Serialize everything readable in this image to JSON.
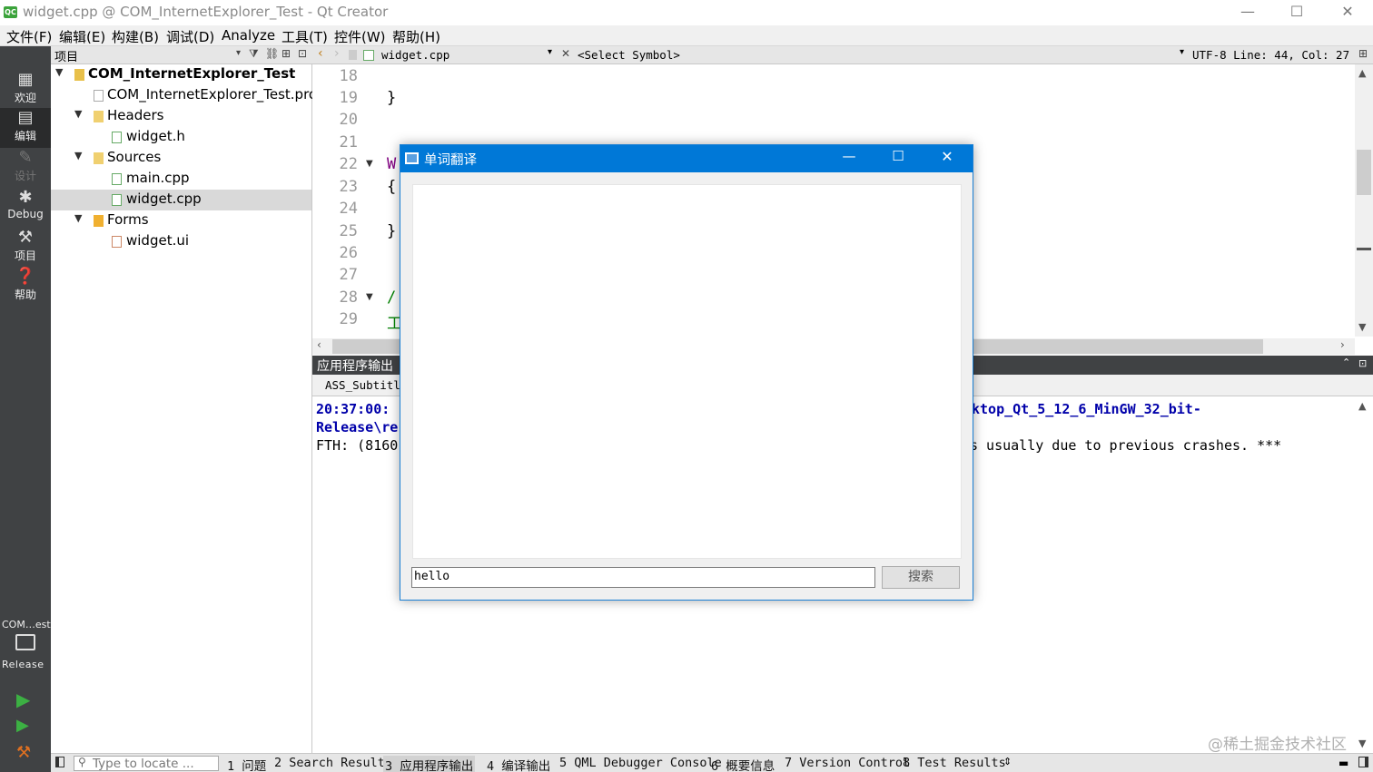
{
  "window": {
    "title": "widget.cpp @ COM_InternetExplorer_Test - Qt Creator",
    "app_icon_text": "QC",
    "minimize": "—",
    "maximize": "☐",
    "close": "✕"
  },
  "menu": [
    "文件(F)",
    "编辑(E)",
    "构建(B)",
    "调试(D)",
    "Analyze",
    "工具(T)",
    "控件(W)",
    "帮助(H)"
  ],
  "modes": [
    {
      "label": "欢迎",
      "icon": "grid-icon"
    },
    {
      "label": "编辑",
      "icon": "edit-icon"
    },
    {
      "label": "设计",
      "icon": "design-icon"
    },
    {
      "label": "Debug",
      "icon": "bug-icon"
    },
    {
      "label": "项目",
      "icon": "wrench-icon"
    },
    {
      "label": "帮助",
      "icon": "help-icon"
    }
  ],
  "kit": {
    "project": "COM…est",
    "config": "Release"
  },
  "project_panel": {
    "title": "项目",
    "tree": [
      {
        "label": "COM_InternetExplorer_Test",
        "level": 0,
        "expanded": true,
        "type": "project"
      },
      {
        "label": "COM_InternetExplorer_Test.pro",
        "level": 1,
        "type": "pro"
      },
      {
        "label": "Headers",
        "level": 1,
        "expanded": true,
        "type": "folder"
      },
      {
        "label": "widget.h",
        "level": 2,
        "type": "header"
      },
      {
        "label": "Sources",
        "level": 1,
        "expanded": true,
        "type": "folder"
      },
      {
        "label": "main.cpp",
        "level": 2,
        "type": "source"
      },
      {
        "label": "widget.cpp",
        "level": 2,
        "type": "source",
        "selected": true
      },
      {
        "label": "Forms",
        "level": 1,
        "expanded": true,
        "type": "forms"
      },
      {
        "label": "widget.ui",
        "level": 2,
        "type": "ui"
      }
    ]
  },
  "editor": {
    "file": "widget.cpp",
    "symbol": "<Select Symbol>",
    "position": "UTF-8 Line: 44, Col: 27",
    "line_numbers": [
      "18",
      "19",
      "20",
      "21",
      "22",
      "23",
      "24",
      "25",
      "26",
      "27",
      "28",
      "29"
    ],
    "code_lines": [
      "",
      "}",
      "",
      "",
      "W",
      "{",
      "",
      "}",
      "",
      "",
      "/",
      "工"
    ]
  },
  "output": {
    "title": "应用程序输出",
    "tab": "ASS_Subtitle",
    "lines": [
      {
        "left": "20:37:00:",
        "right": "ktop_Qt_5_12_6_MinGW_32_bit-"
      },
      {
        "left": "Release\\re",
        "right": ""
      },
      {
        "left": "FTH: (8160",
        "right": "s usually due to previous crashes. ***"
      }
    ]
  },
  "statusbar": {
    "locate_placeholder": "Type to locate ...",
    "tabs": [
      "1 问题",
      "2 Search Results",
      "3 应用程序输出",
      "4 编译输出",
      "5 QML Debugger Console",
      "6 概要信息",
      "7 Version Control",
      "8 Test Results"
    ]
  },
  "dialog": {
    "title": "单词翻译",
    "input_value": "hello",
    "button_label": "搜索"
  },
  "watermark": "@稀土掘金技术社区",
  "colors": {
    "accent": "#0078d7",
    "modebar": "#404244",
    "code_purple": "#800080",
    "comment_green": "#008000",
    "output_blue": "#0000aa"
  }
}
